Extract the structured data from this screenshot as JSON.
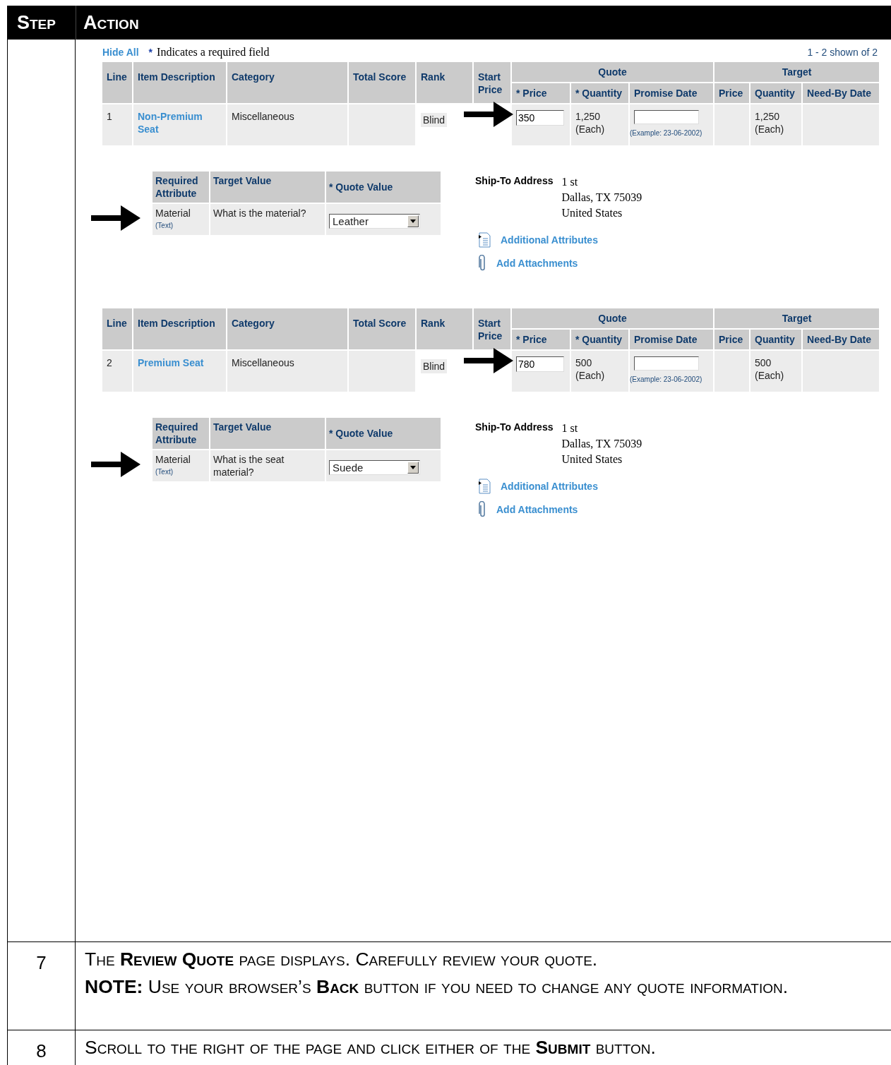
{
  "header": {
    "step": "Step",
    "action": "Action"
  },
  "toolbar": {
    "hide_all": "Hide All",
    "required_mark": "*",
    "required_note": "Indicates a required field",
    "count": "1 - 2 shown of 2"
  },
  "lines": [
    {
      "headers": {
        "line": "Line",
        "item": "Item Description",
        "category": "Category",
        "total_score": "Total Score",
        "rank": "Rank",
        "start_price": "Start Price",
        "quote": "Quote",
        "target": "Target",
        "quote_price": "* Price",
        "quote_quantity": "* Quantity",
        "promise_date": "Promise Date",
        "target_price": "Price",
        "target_quantity": "Quantity",
        "need_by_date": "Need-By Date"
      },
      "row": {
        "line": "1",
        "item": "Non-Premium Seat",
        "category": "Miscellaneous",
        "rank": "Blind",
        "price": "350",
        "quantity": "1,250",
        "unit": "(Each)",
        "date_hint": "(Example: 23-06-2002)",
        "target_quantity": "1,250",
        "target_unit": "(Each)"
      },
      "attributes": {
        "headers": [
          "Required Attribute",
          "Target Value",
          "* Quote Value"
        ],
        "name": "Material",
        "type": "(Text)",
        "target": "What is the material?",
        "value": "Leather"
      },
      "ship_to": {
        "label": "Ship-To Address",
        "address": [
          "1 st",
          "Dallas, TX 75039",
          "United States"
        ]
      },
      "links": [
        {
          "kind": "attributes",
          "label": "Additional Attributes"
        },
        {
          "kind": "attachments",
          "label": "Add Attachments"
        }
      ]
    },
    {
      "headers": {
        "line": "Line",
        "item": "Item Description",
        "category": "Category",
        "total_score": "Total Score",
        "rank": "Rank",
        "start_price": "Start Price",
        "quote": "Quote",
        "target": "Target",
        "quote_price": "* Price",
        "quote_quantity": "* Quantity",
        "promise_date": "Promise Date",
        "target_price": "Price",
        "target_quantity": "Quantity",
        "need_by_date": "Need-By Date"
      },
      "row": {
        "line": "2",
        "item": "Premium Seat",
        "category": "Miscellaneous",
        "rank": "Blind",
        "price": "780",
        "quantity": "500",
        "unit": "(Each)",
        "date_hint": "(Example: 23-06-2002)",
        "target_quantity": "500",
        "target_unit": "(Each)"
      },
      "attributes": {
        "headers": [
          "Required Attribute",
          "Target Value",
          "* Quote Value"
        ],
        "name": "Material",
        "type": "(Text)",
        "target": "What is the seat material?",
        "value": "Suede"
      },
      "ship_to": {
        "label": "Ship-To Address",
        "address": [
          "1 st",
          "Dallas, TX 75039",
          "United States"
        ]
      },
      "links": [
        {
          "kind": "attributes",
          "label": "Additional Attributes"
        },
        {
          "kind": "attachments",
          "label": "Add Attachments"
        }
      ]
    }
  ],
  "steps": [
    {
      "number": "7",
      "paragraphs": [
        "The **Review Quote** page displays. Carefully review your quote.",
        "**NOTE:** Use your browser’s **Back** button if you need to change any quote information."
      ]
    },
    {
      "number": "8",
      "paragraphs": [
        "Scroll to the right of the page and click either of the **Submit** button."
      ]
    }
  ]
}
